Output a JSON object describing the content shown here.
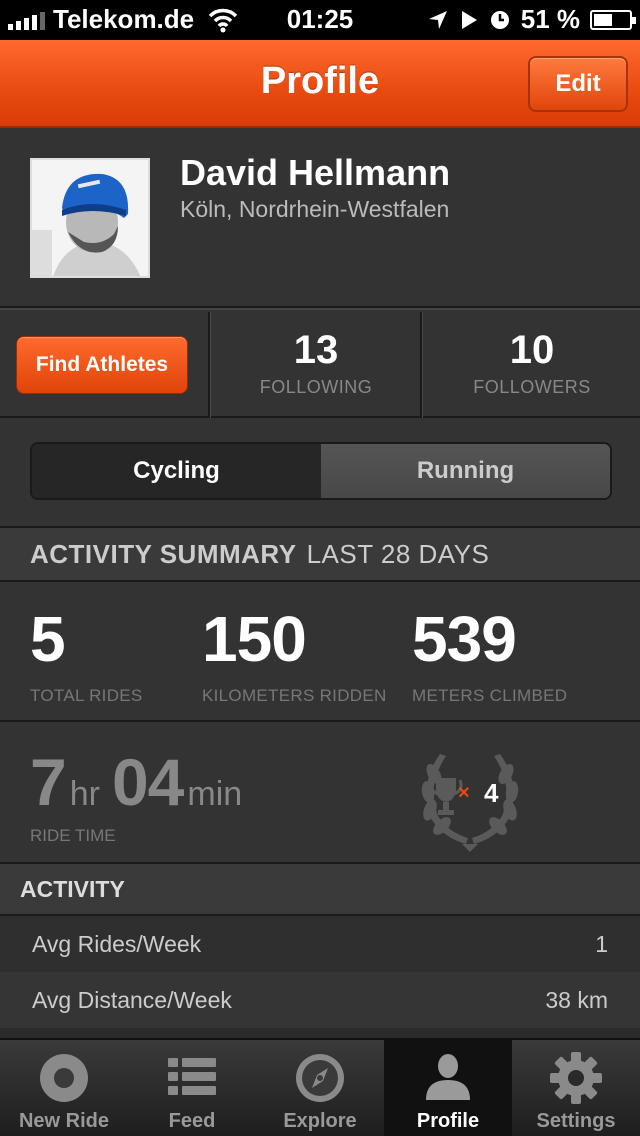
{
  "status_bar": {
    "carrier": "Telekom.de",
    "time": "01:25",
    "battery": "51 %"
  },
  "nav": {
    "title": "Profile",
    "edit_label": "Edit"
  },
  "profile": {
    "name": "David Hellmann",
    "location": "Köln, Nordrhein-Westfalen"
  },
  "stats": {
    "find_athletes_label": "Find Athletes",
    "following_count": "13",
    "following_label": "FOLLOWING",
    "followers_count": "10",
    "followers_label": "FOLLOWERS"
  },
  "segment": {
    "cycling": "Cycling",
    "running": "Running",
    "selected": "Cycling"
  },
  "summary": {
    "title": "ACTIVITY SUMMARY",
    "period": "LAST 28 DAYS",
    "total_rides": "5",
    "total_rides_label": "TOTAL RIDES",
    "km": "150",
    "km_label": "KILOMETERS RIDDEN",
    "meters": "539",
    "meters_label": "METERS CLIMBED",
    "ride_hours": "7",
    "hr_unit": "hr",
    "ride_minutes": "04",
    "min_unit": "min",
    "ride_time_label": "RIDE TIME",
    "trophy_x": "×",
    "trophy_count": "4"
  },
  "activity": {
    "header": "ACTIVITY",
    "rows": [
      {
        "label": "Avg Rides/Week",
        "value": "1"
      },
      {
        "label": "Avg Distance/Week",
        "value": "38 km"
      }
    ]
  },
  "tabs": [
    {
      "label": "New Ride",
      "icon": "record-icon"
    },
    {
      "label": "Feed",
      "icon": "list-icon"
    },
    {
      "label": "Explore",
      "icon": "compass-icon"
    },
    {
      "label": "Profile",
      "icon": "person-icon"
    },
    {
      "label": "Settings",
      "icon": "gear-icon"
    }
  ],
  "colors": {
    "accent": "#e84a10",
    "background": "#333333"
  }
}
